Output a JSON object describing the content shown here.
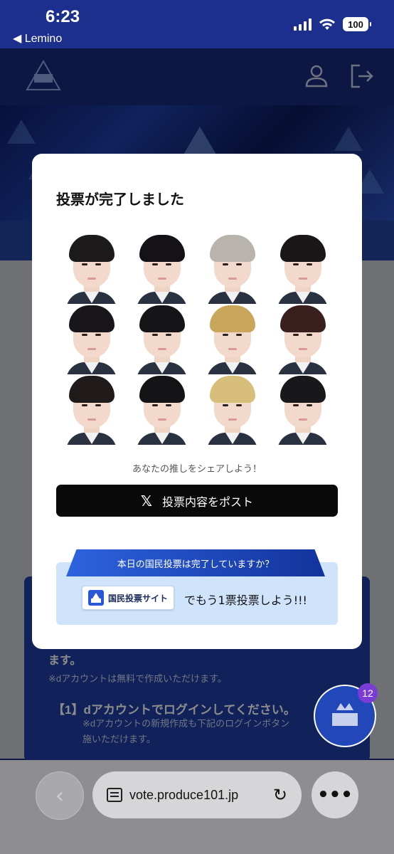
{
  "status": {
    "time": "6:23",
    "back_app": "◀ Lemino",
    "battery": "100"
  },
  "modal": {
    "title": "投票が完了しました",
    "share_text": "あなたの推しをシェアしよう！",
    "post_button": "投票内容をポスト",
    "x_icon": "𝕏",
    "vote_question": "本日の国民投票は完了していますか？",
    "site_button": "国民投票サイト",
    "vote_more": "でもう1票投票しよう!!!"
  },
  "faces": [
    {
      "hair": "#1d1a1c"
    },
    {
      "hair": "#141216"
    },
    {
      "hair": "#b8b3ad"
    },
    {
      "hair": "#1b1719"
    },
    {
      "hair": "#18161a"
    },
    {
      "hair": "#151417"
    },
    {
      "hair": "#c9a659"
    },
    {
      "hair": "#3a1f1f"
    },
    {
      "hair": "#201b1a"
    },
    {
      "hair": "#141316"
    },
    {
      "hair": "#d7be7a"
    },
    {
      "hair": "#18171a"
    }
  ],
  "background": {
    "card_line1": "ます。",
    "card_line2": "※dアカウントは無料で作成いただけます。",
    "card_line3": "【1】dアカウントでログインしてください。",
    "card_line4": "※dアカウントの新規作成も下記のログインボタン",
    "card_line5": "施いただけます。"
  },
  "fab": {
    "badge": "12"
  },
  "browser": {
    "url": "vote.produce101.jp",
    "back": "‹",
    "reload": "↻",
    "more": "•••"
  },
  "colors": {
    "header": "#1c2f8c",
    "accent": "#2e63df",
    "post_button": "#0a0a0a"
  }
}
